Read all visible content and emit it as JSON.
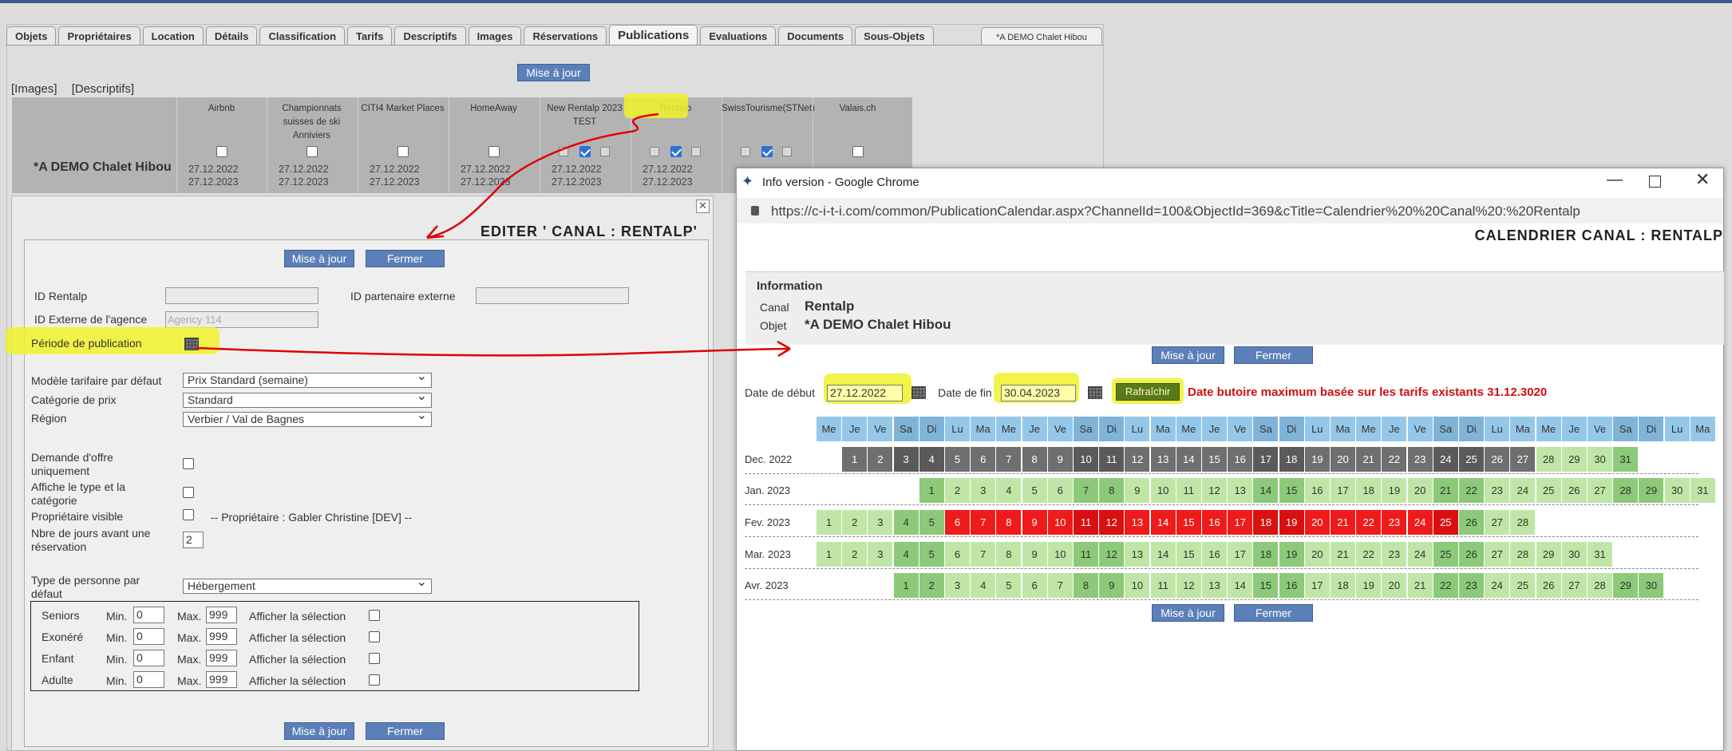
{
  "tabs": [
    "Objets",
    "Propriétaires",
    "Location",
    "Détails",
    "Classification",
    "Tarifs",
    "Descriptifs",
    "Images",
    "Réservations",
    "Publications",
    "Evaluations",
    "Documents",
    "Sous-Objets"
  ],
  "active_tab": "Publications",
  "object_tab": "*A DEMO Chalet Hibou",
  "main_update_button": "Mise à jour",
  "links": [
    "[Images]",
    "[Descriptifs]"
  ],
  "channels": [
    {
      "name": "Airbnb",
      "date1": "27.12.2022",
      "date2": "27.12.2023",
      "checked": false
    },
    {
      "name": "Championnats suisses de ski Anniviers",
      "date1": "27.12.2022",
      "date2": "27.12.2023",
      "checked": false
    },
    {
      "name": "CITI4 Market Places",
      "date1": "27.12.2022",
      "date2": "27.12.2023",
      "checked": false
    },
    {
      "name": "HomeAway",
      "date1": "27.12.2022",
      "date2": "27.12.2023",
      "checked": false
    },
    {
      "name": "New Rentalp 2023 TEST",
      "date1": "27.12.2022",
      "date2": "27.12.2023",
      "checked": true
    },
    {
      "name": "Rentalp",
      "date1": "27.12.2022",
      "date2": "27.12.2023",
      "checked": true
    },
    {
      "name": "SwissTourisme(STNet)",
      "date1": "",
      "date2": "",
      "checked": true
    },
    {
      "name": "Valais.ch",
      "date1": "",
      "date2": "",
      "checked": false
    }
  ],
  "object_name": "*A DEMO Chalet Hibou",
  "editor": {
    "title": "EDITER ' CANAL : RENTALP'",
    "update_button": "Mise à jour",
    "close_button": "Fermer",
    "id_rentalp_label": "ID Rentalp",
    "id_partner_label": "ID partenaire externe",
    "id_agency_label": "ID Externe de l'agence",
    "id_agency_placeholder": "Agency 114",
    "period_label": "Période de publication",
    "tariff_model_label": "Modèle tarifaire par défaut",
    "tariff_model_value": "Prix Standard (semaine)",
    "price_cat_label": "Catégorie de prix",
    "price_cat_value": "Standard",
    "region_label": "Région",
    "region_value": "Verbier / Val de Bagnes",
    "offer_only_label": "Demande d'offre uniquement",
    "show_type_label": "Affiche le type et la catégorie",
    "owner_visible_label": "Propriétaire visible",
    "owner_text": "-- Propriétaire : Gabler Christine [DEV] --",
    "days_before_label": "Nbre de jours avant une réservation",
    "days_before_value": "2",
    "person_type_label": "Type de personne par défaut",
    "person_type_value": "Hébergement",
    "persons": [
      {
        "name": "Seniors",
        "min": "0",
        "max": "999"
      },
      {
        "name": "Exonéré",
        "min": "0",
        "max": "999"
      },
      {
        "name": "Enfant",
        "min": "0",
        "max": "999"
      },
      {
        "name": "Adulte",
        "min": "0",
        "max": "999"
      }
    ],
    "min_label": "Min.",
    "max_label": "Max.",
    "show_selection_label": "Afficher la sélection"
  },
  "chrome": {
    "window_title": "Info version - Google Chrome",
    "url": "https://c-i-t-i.com/common/PublicationCalendar.aspx?ChannelId=100&ObjectId=369&cTitle=Calendrier%20%20Canal%20:%20Rentalp"
  },
  "calendar": {
    "title": "CALENDRIER CANAL : RENTALP",
    "info_heading": "Information",
    "canal_label": "Canal",
    "canal_value": "Rentalp",
    "objet_label": "Objet",
    "objet_value": "*A DEMO Chalet Hibou",
    "update_button": "Mise à jour",
    "close_button": "Fermer",
    "start_label": "Date de début",
    "start_value": "27.12.2022",
    "end_label": "Date de fin",
    "end_value": "30.04.2023",
    "refresh_button": "Rafraîchir",
    "deadline_text": "Date butoire maximum basée sur les tarifs existants  31.12.3020",
    "weekday_headers": [
      "Me",
      "Je",
      "Ve",
      "Sa",
      "Di",
      "Lu",
      "Ma",
      "Me",
      "Je",
      "Ve",
      "Sa",
      "Di",
      "Lu",
      "Ma",
      "Me",
      "Je",
      "Ve",
      "Sa",
      "Di",
      "Lu",
      "Ma",
      "Me",
      "Je",
      "Ve",
      "Sa",
      "Di",
      "Lu",
      "Ma",
      "Me",
      "Je",
      "Ve",
      "Sa",
      "Di",
      "Lu",
      "Ma"
    ],
    "months": [
      {
        "label": "Dec. 2022",
        "offset": 1,
        "days": 31,
        "blocked_from": 0,
        "blocked_to": 0,
        "past_until": 27
      },
      {
        "label": "Jan. 2023",
        "offset": 4,
        "days": 31,
        "blocked_from": 0,
        "blocked_to": 0,
        "past_until": 0
      },
      {
        "label": "Fev. 2023",
        "offset": 0,
        "days": 28,
        "blocked_from": 6,
        "blocked_to": 25,
        "past_until": 0
      },
      {
        "label": "Mar. 2023",
        "offset": 0,
        "days": 31,
        "blocked_from": 0,
        "blocked_to": 0,
        "past_until": 0
      },
      {
        "label": "Avr. 2023",
        "offset": 3,
        "days": 30,
        "blocked_from": 0,
        "blocked_to": 0,
        "past_until": 0
      }
    ]
  }
}
